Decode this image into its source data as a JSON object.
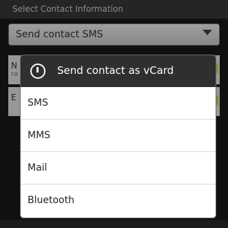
{
  "background": {
    "header_title": "Select Contact Information",
    "dropdown_value": "Send contact SMS",
    "rows": [
      {
        "title": "N",
        "subtitle": "ra"
      },
      {
        "title": "E",
        "subtitle": ""
      }
    ]
  },
  "dialog": {
    "title": "Send contact as vCard",
    "options": [
      {
        "label": "SMS"
      },
      {
        "label": "MMS"
      },
      {
        "label": "Mail"
      },
      {
        "label": "Bluetooth"
      }
    ]
  },
  "colors": {
    "title_bar": "#2f2f2f",
    "dialog_bg": "#ffffff",
    "accent_check": "#c8d94a"
  }
}
